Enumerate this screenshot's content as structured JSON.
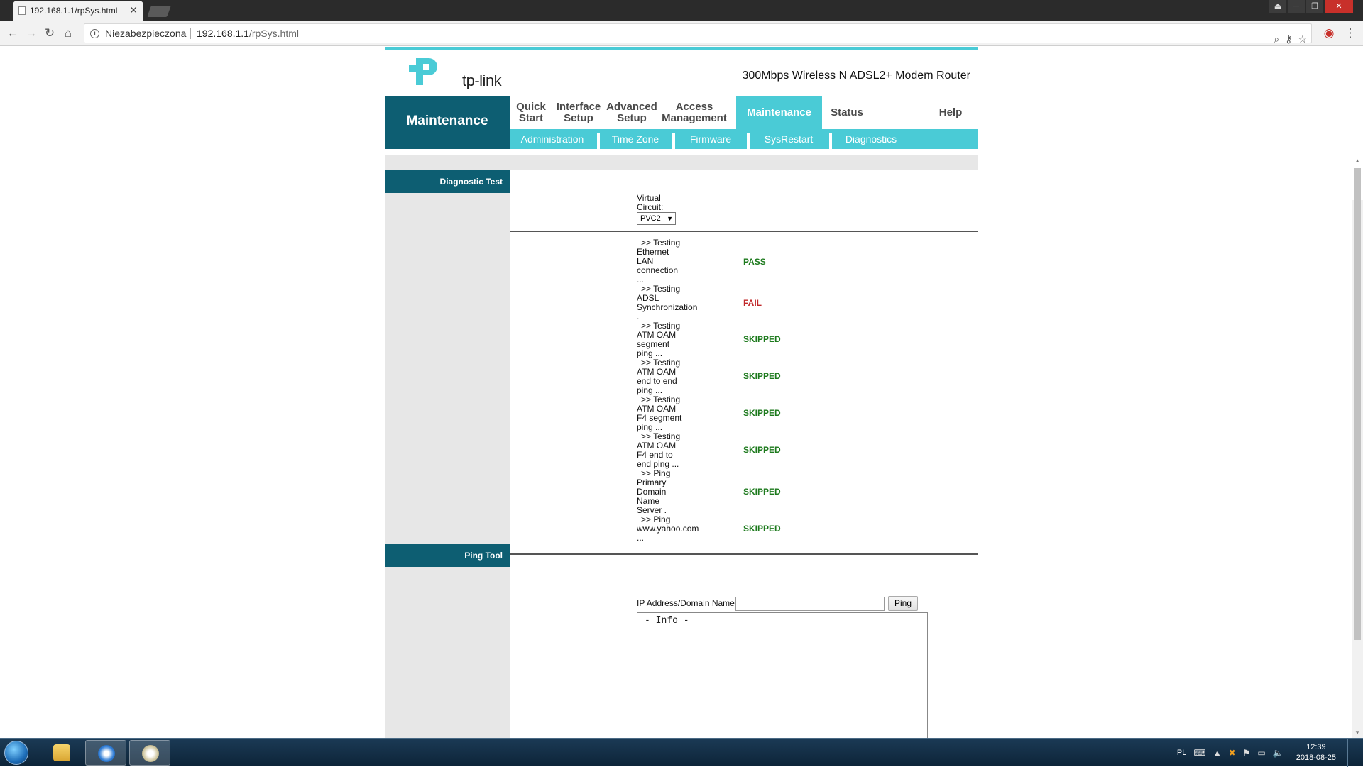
{
  "browser": {
    "tab_title": "192.168.1.1/rpSys.html",
    "tab_close": "✕",
    "security_label": "Niezabezpieczona",
    "url_host": "192.168.1.1",
    "url_path": "/rpSys.html",
    "window_controls": [
      "⏏",
      "─",
      "❐",
      "✕"
    ]
  },
  "router": {
    "logo_text": "tp-link",
    "model": "300Mbps Wireless N ADSL2+ Modem Router",
    "section_title": "Maintenance",
    "menu": [
      {
        "label": "Quick Start"
      },
      {
        "label": "Interface Setup"
      },
      {
        "label": "Advanced Setup"
      },
      {
        "label": "Access Management"
      },
      {
        "label": "Maintenance",
        "active": true
      },
      {
        "label": "Status"
      },
      {
        "label": "Help"
      }
    ],
    "submenu": [
      "Administration",
      "Time Zone",
      "Firmware",
      "SysRestart",
      "Diagnostics"
    ],
    "accent_color": "#4acbd6",
    "dark_color": "#0d5e72"
  },
  "diagnostic": {
    "section_label": "Diagnostic Test",
    "vc_label": "Virtual Circuit:",
    "vc_value": "PVC2",
    "tests": [
      {
        "lines": [
          ">> Testing",
          "Ethernet",
          "LAN",
          "connection",
          "..."
        ],
        "result": "PASS",
        "status": "pass"
      },
      {
        "lines": [
          ">> Testing",
          "ADSL",
          "Synchronization",
          "."
        ],
        "result": "FAIL",
        "status": "fail"
      },
      {
        "lines": [
          ">> Testing",
          "ATM OAM",
          "segment",
          "ping ..."
        ],
        "result": "SKIPPED",
        "status": "skip"
      },
      {
        "lines": [
          ">> Testing",
          "ATM OAM",
          "end to end",
          "ping ..."
        ],
        "result": "SKIPPED",
        "status": "skip"
      },
      {
        "lines": [
          ">> Testing",
          "ATM OAM",
          "F4 segment",
          "ping ..."
        ],
        "result": "SKIPPED",
        "status": "skip"
      },
      {
        "lines": [
          ">> Testing",
          "ATM OAM",
          "F4 end to",
          "end ping ..."
        ],
        "result": "SKIPPED",
        "status": "skip"
      },
      {
        "lines": [
          ">> Ping",
          "Primary",
          "Domain",
          "Name",
          "Server ."
        ],
        "result": "SKIPPED",
        "status": "skip"
      },
      {
        "lines": [
          ">> Ping",
          "www.yahoo.com",
          "..."
        ],
        "result": "SKIPPED",
        "status": "skip"
      }
    ]
  },
  "ping": {
    "section_label": "Ping Tool",
    "field_label": "IP Address/Domain Name:",
    "input_value": "",
    "button_label": "Ping",
    "output": "- Info -"
  },
  "taskbar": {
    "language": "PL",
    "time": "12:39",
    "date": "2018-08-25"
  }
}
